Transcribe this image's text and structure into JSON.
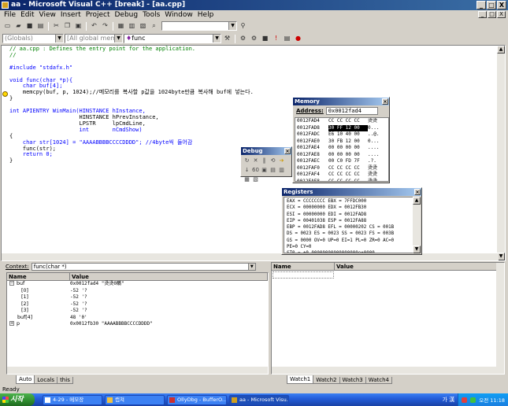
{
  "window": {
    "title": "aa - Microsoft Visual C++ [break] - [aa.cpp]",
    "buttons": [
      "_",
      "□",
      "X"
    ]
  },
  "menu": [
    "File",
    "Edit",
    "View",
    "Insert",
    "Project",
    "Debug",
    "Tools",
    "Window",
    "Help"
  ],
  "mdi_buttons": [
    "_",
    "□",
    "X"
  ],
  "toolbar": {
    "scope_combo": "(Globals)",
    "members_combo": "[All global members",
    "function_combo": "func",
    "find_combo": ""
  },
  "editor": {
    "lines": [
      {
        "t": "// aa.cpp : Defines the entry point for the application.",
        "c": "comment"
      },
      {
        "t": "//",
        "c": "comment"
      },
      {
        "t": "",
        "c": "plain"
      },
      {
        "t": "#include \"stdafx.h\"",
        "c": "kw"
      },
      {
        "t": "",
        "c": "plain"
      },
      {
        "t": "void func(char *p){",
        "c": "kw"
      },
      {
        "t": "    char buf[4];",
        "c": "kw"
      },
      {
        "t": "    memcpy(buf, p, 1024);//메모리를 복사할 p값을 1024byte만큼 복사해 buf에 넣는다.",
        "c": "plain"
      },
      {
        "t": "}",
        "c": "plain"
      },
      {
        "t": "",
        "c": "plain"
      },
      {
        "t": "int APIENTRY WinMain(HINSTANCE hInstance,",
        "c": "kw"
      },
      {
        "t": "                     HINSTANCE hPrevInstance,",
        "c": "plain"
      },
      {
        "t": "                     LPSTR     lpCmdLine,",
        "c": "plain"
      },
      {
        "t": "                     int       nCmdShow)",
        "c": "kw"
      },
      {
        "t": "{",
        "c": "plain"
      },
      {
        "t": "    char str[1024] = \"AAAABBBBCCCCDDDD\"; //4byte씩 들어감",
        "c": "kw"
      },
      {
        "t": "    func(str);",
        "c": "plain"
      },
      {
        "t": "    return 0;",
        "c": "kw"
      },
      {
        "t": "}",
        "c": "plain"
      }
    ]
  },
  "memory": {
    "title": "Memory",
    "address_label": "Address:",
    "address_value": "0x0012fad4",
    "rows": [
      {
        "addr": "0012FAD4",
        "hex": "CC CC CC CC",
        "ascii": "烫烫"
      },
      {
        "addr": "0012FAD8",
        "hex": "30 FF 12 00",
        "ascii": "0...",
        "selected": true
      },
      {
        "addr": "0012FADC",
        "hex": "E6 10 40 00",
        "ascii": "..@."
      },
      {
        "addr": "0012FAE0",
        "hex": "30 FB 12 00",
        "ascii": "0..."
      },
      {
        "addr": "0012FAE4",
        "hex": "00 00 00 00",
        "ascii": "...."
      },
      {
        "addr": "0012FAE8",
        "hex": "00 00 00 00",
        "ascii": "...."
      },
      {
        "addr": "0012FAEC",
        "hex": "00 C0 FD 7F",
        "ascii": ".?."
      },
      {
        "addr": "0012FAF0",
        "hex": "CC CC CC CC",
        "ascii": "烫烫"
      },
      {
        "addr": "0012FAF4",
        "hex": "CC CC CC CC",
        "ascii": "烫烫"
      },
      {
        "addr": "0012FAF8",
        "hex": "CC CC CC CC",
        "ascii": "烫烫"
      }
    ]
  },
  "debug_toolbar": {
    "title": "Debug"
  },
  "registers": {
    "title": "Registers",
    "lines": [
      "EAX = CCCCCCCC EBX = 7FFDC000",
      "ECX = 00000000 EDX = 0012FB30",
      "ESI = 00000000 EDI = 0012FAD8",
      "EIP = 00401038 ESP = 0012FA88",
      "EBP = 0012FAD8 EFL = 00000202 CS = 001B",
      "DS = 0023 ES = 0023 SS = 0023 FS = 003B",
      "GS = 0000 OV=0 UP=0 EI=1 PL=0 ZR=0 AC=0",
      "PE=0 CY=0",
      "ST0 = +0.00000000000000000e+0000"
    ]
  },
  "variables": {
    "context_label": "Context:",
    "context_value": "func(char *)",
    "headers": [
      "Name",
      "Value"
    ],
    "rows": [
      {
        "name": "buf",
        "value": "0x0012fad4 \"烫烫0鵰\"",
        "exp": "−",
        "indent": 0
      },
      {
        "name": "[0]",
        "value": "-52 '?",
        "exp": "",
        "indent": 1
      },
      {
        "name": "[1]",
        "value": "-52 '?",
        "exp": "",
        "indent": 1
      },
      {
        "name": "[2]",
        "value": "-52 '?",
        "exp": "",
        "indent": 1
      },
      {
        "name": "[3]",
        "value": "-52 '?",
        "exp": "",
        "indent": 1
      },
      {
        "name": "buf[4]",
        "value": "48 '0'",
        "exp": "",
        "indent": 0
      },
      {
        "name": "p",
        "value": "0x0012fb30 \"AAAABBBBCCCCDDDD\"",
        "exp": "+",
        "indent": 0
      }
    ],
    "tabs": [
      "Auto",
      "Locals",
      "this"
    ]
  },
  "watch": {
    "headers": [
      "Name",
      "Value"
    ],
    "tabs": [
      "Watch1",
      "Watch2",
      "Watch3",
      "Watch4"
    ]
  },
  "status": {
    "text": "Ready"
  },
  "taskbar": {
    "start_label": "시작",
    "tasks": [
      {
        "label": "4-29 - 메모장",
        "color": "#ffffff"
      },
      {
        "label": "캡쳐",
        "color": "#f0c040"
      },
      {
        "label": "OllyDbg - BufferO...",
        "color": "#cc3030"
      },
      {
        "label": "aa - Microsoft Visu...",
        "color": "#d0a020",
        "active": true
      }
    ],
    "ime": "가 漢",
    "clock": "오전 11:18"
  },
  "colors": {
    "title_start": "#0a246a",
    "title_end": "#3a6ea5",
    "comment": "#008000",
    "keyword": "#0000ff",
    "taskbar": "#245edb",
    "start": "#2e8b2e"
  }
}
